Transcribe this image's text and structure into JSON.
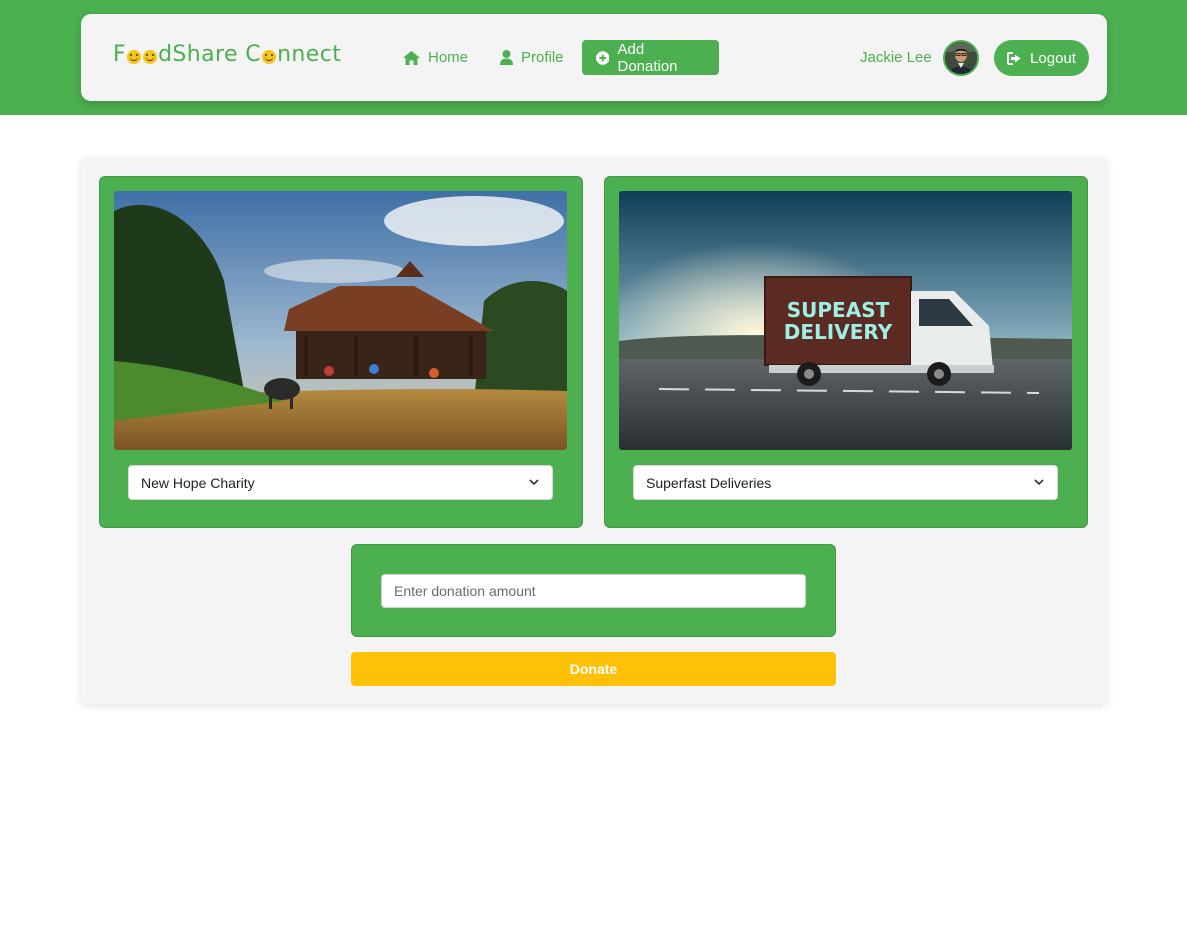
{
  "brand": {
    "logo_parts": [
      "F",
      "dShare C",
      "nnect"
    ],
    "logo_text": "FoodShare Connect",
    "color": "#4caf50"
  },
  "nav": {
    "home": {
      "label": "Home",
      "icon": "home-icon"
    },
    "profile": {
      "label": "Profile",
      "icon": "user-icon"
    },
    "add_donation": {
      "label": "Add Donation",
      "icon": "plus-circle-icon"
    }
  },
  "user": {
    "name": "Jackie Lee",
    "avatar": "avatar"
  },
  "logout": {
    "label": "Logout",
    "icon": "logout-icon"
  },
  "cards": {
    "charity": {
      "selected": "New Hope Charity",
      "image": "village-shelter-photo"
    },
    "delivery": {
      "selected": "Superfast Deliveries",
      "image": "delivery-truck-photo",
      "truck_text": [
        "SUPEAST",
        "DELIVERY"
      ]
    }
  },
  "donation": {
    "amount_placeholder": "Enter donation amount",
    "amount_value": "",
    "button_label": "Donate"
  },
  "colors": {
    "accent": "#4caf50",
    "donate": "#ffc107",
    "panel": "#f4f4f4"
  }
}
